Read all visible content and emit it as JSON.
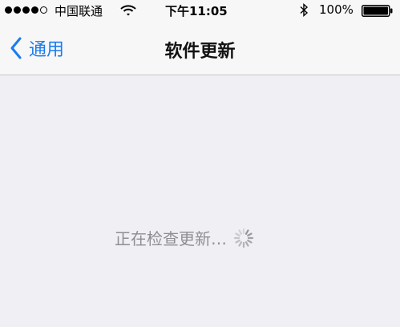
{
  "status_bar": {
    "carrier": "中国联通",
    "time": "下午11:05",
    "battery": "100%",
    "signal_bars": 4,
    "signal_total": 5,
    "icons": [
      "signal-dots-icon",
      "wifi-icon",
      "bluetooth-icon",
      "battery-icon"
    ]
  },
  "nav": {
    "back_label": "通用",
    "title": "软件更新",
    "accent_color": "#1a7cf0"
  },
  "main": {
    "status_text": "正在检查更新…",
    "spinner_icon": "activity-spinner-icon"
  }
}
